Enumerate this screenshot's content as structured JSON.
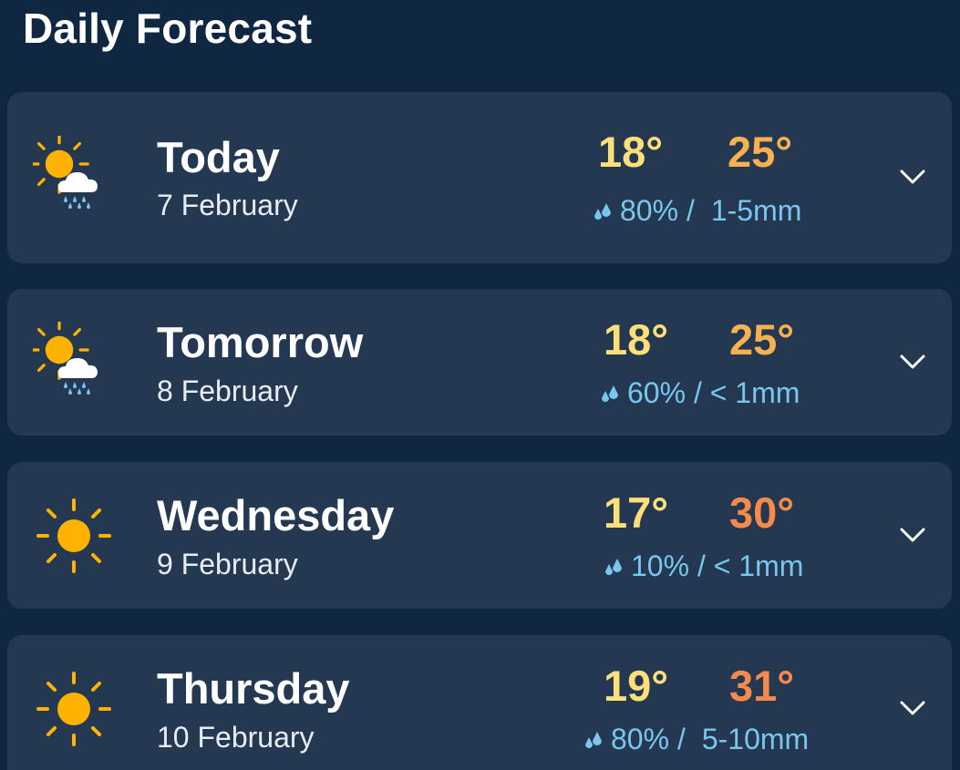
{
  "header": {
    "title": "Daily Forecast"
  },
  "colors": {
    "background": "#0f2740",
    "card": "#243851",
    "min_temp": "#fde07a",
    "rain": "#79c6ef",
    "sun": "#ffb300"
  },
  "days": [
    {
      "day": "Today",
      "date": "7 February",
      "min": "18°",
      "max": "25°",
      "max_color": "#f9b04e",
      "chance": "80% /",
      "amount": "1-5mm",
      "icon": "sun-cloud-rain-icon"
    },
    {
      "day": "Tomorrow",
      "date": "8 February",
      "min": "18°",
      "max": "25°",
      "max_color": "#f9b04e",
      "chance": "60% /",
      "amount": "< 1mm",
      "icon": "sun-cloud-rain-icon"
    },
    {
      "day": "Wednesday",
      "date": "9 February",
      "min": "17°",
      "max": "30°",
      "max_color": "#f58a4c",
      "chance": "10% /",
      "amount": "< 1mm",
      "icon": "sun-icon"
    },
    {
      "day": "Thursday",
      "date": "10 February",
      "min": "19°",
      "max": "31°",
      "max_color": "#f58a4c",
      "chance": "80% /",
      "amount": "5-10mm",
      "icon": "sun-icon"
    }
  ]
}
